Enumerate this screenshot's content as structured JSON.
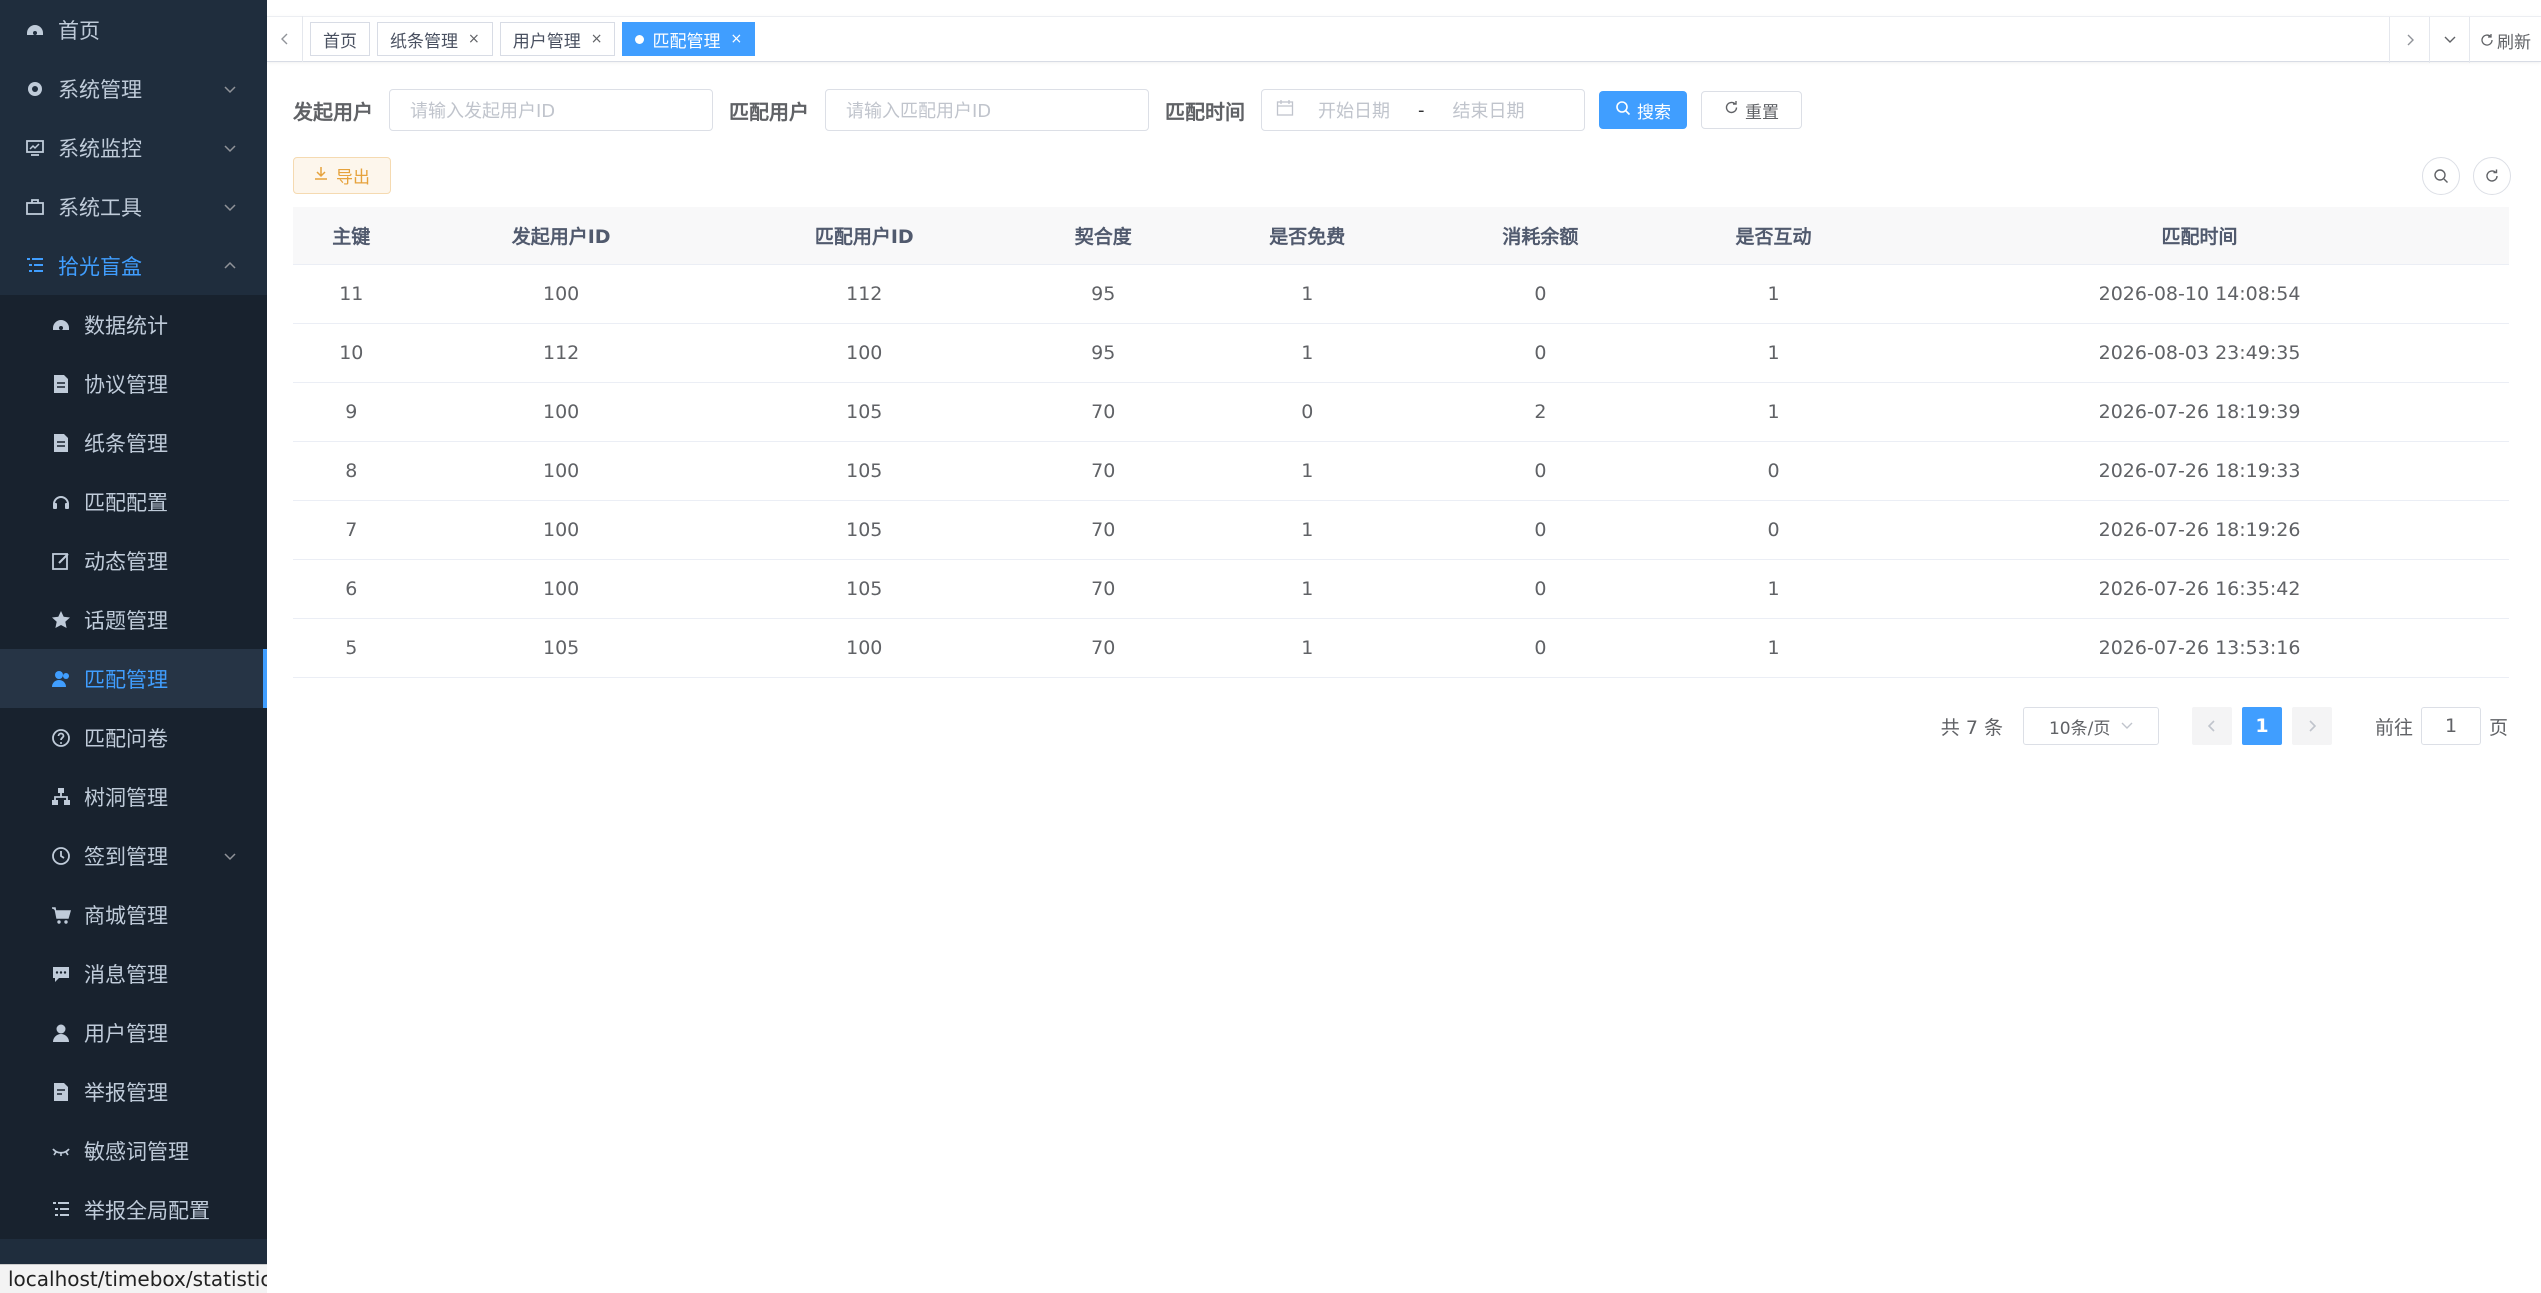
{
  "sidebar": {
    "items": [
      {
        "label": "首页",
        "icon": "dashboard-icon",
        "chevron": false
      },
      {
        "label": "系统管理",
        "icon": "gear-icon",
        "chevron": true
      },
      {
        "label": "系统监控",
        "icon": "monitor-icon",
        "chevron": true
      },
      {
        "label": "系统工具",
        "icon": "toolbox-icon",
        "chevron": true
      },
      {
        "label": "拾光盲盒",
        "icon": "tree-list-icon",
        "chevron": true,
        "open": true
      }
    ],
    "subitems": [
      {
        "label": "数据统计",
        "icon": "dashboard-icon"
      },
      {
        "label": "协议管理",
        "icon": "document-icon"
      },
      {
        "label": "纸条管理",
        "icon": "document-icon"
      },
      {
        "label": "匹配配置",
        "icon": "headset-icon"
      },
      {
        "label": "动态管理",
        "icon": "edit-icon"
      },
      {
        "label": "话题管理",
        "icon": "star-icon"
      },
      {
        "label": "匹配管理",
        "icon": "peoples-icon",
        "active": true
      },
      {
        "label": "匹配问卷",
        "icon": "question-icon"
      },
      {
        "label": "树洞管理",
        "icon": "tree-icon"
      },
      {
        "label": "签到管理",
        "icon": "clock-icon",
        "chevron": true
      },
      {
        "label": "商城管理",
        "icon": "cart-icon"
      },
      {
        "label": "消息管理",
        "icon": "message-icon"
      },
      {
        "label": "用户管理",
        "icon": "user-icon"
      },
      {
        "label": "举报管理",
        "icon": "report-icon"
      },
      {
        "label": "敏感词管理",
        "icon": "eye-closed-icon"
      },
      {
        "label": "举报全局配置",
        "icon": "list-icon"
      }
    ]
  },
  "statusbar": {
    "url": "localhost/timebox/statistics"
  },
  "tags": {
    "items": [
      {
        "label": "首页",
        "closable": false
      },
      {
        "label": "纸条管理",
        "closable": true
      },
      {
        "label": "用户管理",
        "closable": true
      },
      {
        "label": "匹配管理",
        "closable": true,
        "active": true
      }
    ],
    "close_glyph": "×",
    "refresh_label": "刷新"
  },
  "search": {
    "from_user_label": "发起用户",
    "from_user_placeholder": "请输入发起用户ID",
    "match_user_label": "匹配用户",
    "match_user_placeholder": "请输入匹配用户ID",
    "time_label": "匹配时间",
    "start_placeholder": "开始日期",
    "range_sep": "-",
    "end_placeholder": "结束日期",
    "search_btn": "搜索",
    "reset_btn": "重置"
  },
  "toolbar": {
    "export_label": "导出"
  },
  "table": {
    "columns": [
      "主键",
      "发起用户ID",
      "匹配用户ID",
      "契合度",
      "是否免费",
      "消耗余额",
      "是否互动",
      "匹配时间"
    ],
    "rows": [
      [
        "11",
        "100",
        "112",
        "95",
        "1",
        "0",
        "1",
        "2026-08-10 14:08:54"
      ],
      [
        "10",
        "112",
        "100",
        "95",
        "1",
        "0",
        "1",
        "2026-08-03 23:49:35"
      ],
      [
        "9",
        "100",
        "105",
        "70",
        "0",
        "2",
        "1",
        "2026-07-26 18:19:39"
      ],
      [
        "8",
        "100",
        "105",
        "70",
        "1",
        "0",
        "0",
        "2026-07-26 18:19:33"
      ],
      [
        "7",
        "100",
        "105",
        "70",
        "1",
        "0",
        "0",
        "2026-07-26 18:19:26"
      ],
      [
        "6",
        "100",
        "105",
        "70",
        "1",
        "0",
        "1",
        "2026-07-26 16:35:42"
      ],
      [
        "5",
        "105",
        "100",
        "70",
        "1",
        "0",
        "1",
        "2026-07-26 13:53:16"
      ]
    ]
  },
  "pagination": {
    "total": "共 7 条",
    "page_size": "10条/页",
    "current_page": "1",
    "goto_prefix": "前往",
    "goto_value": "1",
    "goto_suffix": "页"
  },
  "colors": {
    "primary": "#409eff",
    "sidebar_bg": "#1f2d3d",
    "warning": "#e6a23c"
  }
}
